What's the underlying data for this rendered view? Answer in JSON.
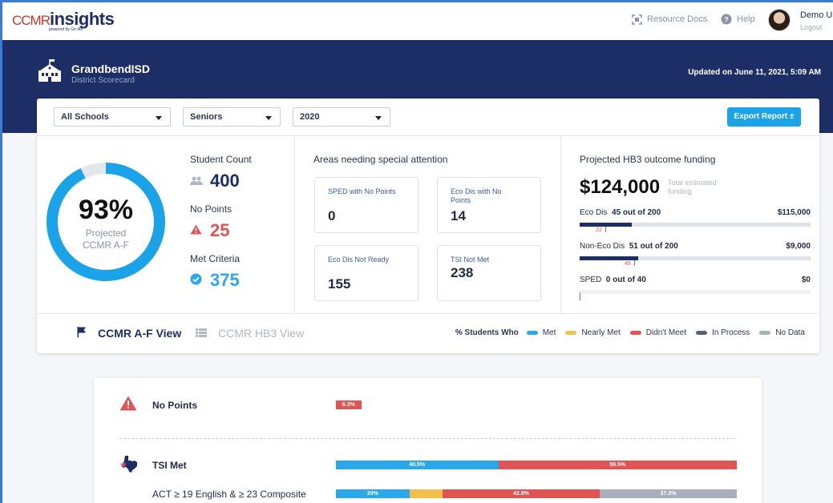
{
  "brand": {
    "logo_left": "CCMR",
    "logo_right": "insights",
    "powered": "powered by Go 4th"
  },
  "topnav": {
    "resource_docs": "Resource Docs",
    "help": "Help",
    "user_name": "Demo Us",
    "logout": "Logout"
  },
  "header": {
    "district_name": "GrandbendISD",
    "district_sub": "District Scorecard",
    "updated": "Updated on June 11, 2021, 5:09 AM"
  },
  "filters": {
    "school": "All Schools",
    "cohort": "Seniors",
    "year": "2020",
    "export_label": "Export Report ±"
  },
  "summary": {
    "percent": "93%",
    "percent_value": 0.93,
    "donut_label": "Projected CCMR A-F",
    "student_count_label": "Student Count",
    "student_count": "400",
    "no_points_label": "No Points",
    "no_points": "25",
    "met_label": "Met Criteria",
    "met": "375"
  },
  "attention": {
    "title": "Areas needing special attention",
    "boxes": [
      {
        "label": "SPED with No Points",
        "value": "0"
      },
      {
        "label": "Eco Dis with No Points",
        "value": "14"
      },
      {
        "label": "Eco Dis Not Ready",
        "value": "155"
      },
      {
        "label": "TSI Not Met",
        "value": "238"
      }
    ]
  },
  "funding": {
    "title": "Projected HB3 outcome funding",
    "amount": "$124,000",
    "amount_sub": "Total estimated funding",
    "rows": [
      {
        "name": "Eco Dis",
        "detail": "45 out of 200",
        "amount": "$115,000",
        "marker": "22",
        "filled": 0.225,
        "hatched": 0.11
      },
      {
        "name": "Non-Eco Dis",
        "detail": "51 out of 200",
        "amount": "$9,000",
        "marker": "48",
        "filled": 0.255,
        "hatched": 0.24
      },
      {
        "name": "SPED",
        "detail": "0 out of 40",
        "amount": "$0",
        "marker": "",
        "filled": 0,
        "hatched": 0
      }
    ]
  },
  "views": {
    "ccmr": "CCMR A-F View",
    "hb3": "CCMR HB3 View"
  },
  "legend": {
    "title": "% Students Who",
    "items": [
      {
        "label": "Met",
        "color": "#2aa8ea"
      },
      {
        "label": "Nearly Met",
        "color": "#f2c04a"
      },
      {
        "label": "Didn't Meet",
        "color": "#e05454"
      },
      {
        "label": "In Process",
        "color": "#5b6170"
      },
      {
        "label": "No Data",
        "color": "#a8afbb"
      }
    ]
  },
  "rows": {
    "no_points": {
      "label": "No Points",
      "segments": [
        {
          "value": 6.3,
          "text": "6.3%",
          "color": "#e05454"
        }
      ]
    },
    "tsi_met": {
      "label": "TSI Met",
      "segments": [
        {
          "value": 40.5,
          "text": "40.5%",
          "color": "#2aa8ea"
        },
        {
          "value": 59.5,
          "text": "59.5%",
          "color": "#e05454"
        }
      ]
    },
    "act": {
      "label": "ACT ≥ 19 English & ≥ 23 Composite",
      "segments": [
        {
          "value": 20,
          "text": "20%",
          "color": "#2aa8ea"
        },
        {
          "value": 9,
          "text": "",
          "color": "#f2c04a"
        },
        {
          "value": 42.8,
          "text": "42.8%",
          "color": "#e05454"
        },
        {
          "value": 37.3,
          "text": "37.3%",
          "color": "#a8afbb"
        }
      ]
    }
  }
}
